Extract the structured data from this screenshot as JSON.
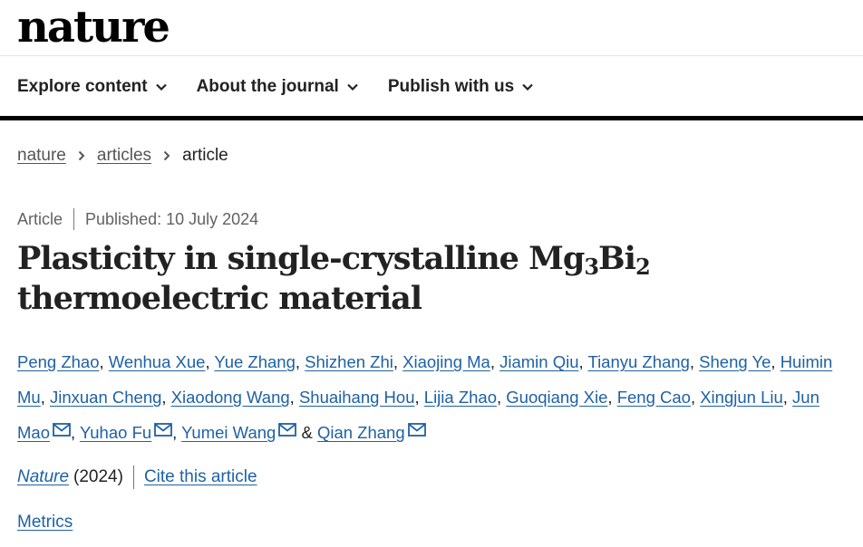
{
  "header": {
    "logo_text": "nature"
  },
  "nav": {
    "items": [
      {
        "label": "Explore content"
      },
      {
        "label": "About the journal"
      },
      {
        "label": "Publish with us"
      }
    ]
  },
  "breadcrumb": {
    "items": [
      "nature",
      "articles"
    ],
    "current": "article"
  },
  "article": {
    "type": "Article",
    "published": "Published: 10 July 2024",
    "title_part1": "Plasticity in single-crystalline Mg",
    "title_sub1": "3",
    "title_part2": "Bi",
    "title_sub2": "2",
    "title_part3": " thermoelectric material",
    "authors": [
      "Peng Zhao",
      "Wenhua Xue",
      "Yue Zhang",
      "Shizhen Zhi",
      "Xiaojing Ma",
      "Jiamin Qiu",
      "Tianyu Zhang",
      "Sheng Ye",
      "Huimin Mu",
      "Jinxuan Cheng",
      "Xiaodong Wang",
      "Shuaihang Hou",
      "Lijia Zhao",
      "Guoqiang Xie",
      "Feng Cao",
      "Xingjun Liu",
      "Jun Mao",
      "Yuhao Fu",
      "Yumei Wang",
      "Qian Zhang"
    ],
    "ampersand": "&",
    "journal": "Nature",
    "year": "(2024)",
    "cite_label": "Cite this article",
    "metrics_label": "Metrics"
  },
  "colors": {
    "link": "#1e61a6",
    "text": "#222222",
    "muted": "#626262",
    "rule": "#000000"
  },
  "icons": [
    "chevron-down-icon",
    "chevron-right-icon",
    "mail-icon"
  ]
}
